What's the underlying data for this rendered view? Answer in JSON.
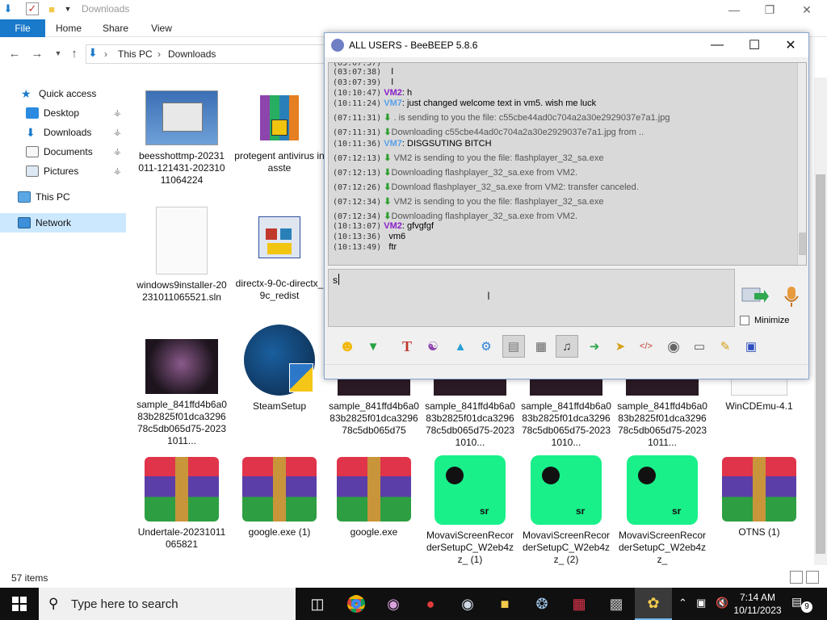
{
  "explorer": {
    "title": "Downloads",
    "ribbon_tabs": [
      "File",
      "Home",
      "Share",
      "View"
    ],
    "breadcrumb": [
      "This PC",
      "Downloads"
    ],
    "nav": [
      {
        "label": "Quick access",
        "icon": "star-icon",
        "pinned": false
      },
      {
        "label": "Desktop",
        "icon": "desktop-icon",
        "pinned": true
      },
      {
        "label": "Downloads",
        "icon": "download-arrow-icon",
        "pinned": true
      },
      {
        "label": "Documents",
        "icon": "documents-icon",
        "pinned": true
      },
      {
        "label": "Pictures",
        "icon": "pictures-icon",
        "pinned": true
      },
      {
        "label": "This PC",
        "icon": "computer-icon",
        "pinned": false
      },
      {
        "label": "Network",
        "icon": "network-icon",
        "pinned": false,
        "selected": true
      }
    ],
    "files": [
      {
        "name": "beesshottmp-20231011-121431-20231011064224",
        "kind": "screenshot"
      },
      {
        "name": "protegent antivirus inasste",
        "kind": "winrar-installer"
      },
      {
        "name": "windows9installer-20231011065521.sln",
        "kind": "blank"
      },
      {
        "name": "directx-9-0c-directx_9c_redist",
        "kind": "installer"
      },
      {
        "name": "sample_841ffd4b6a083b2825f01dca329678c5db065d75-20231011...",
        "kind": "dark-image"
      },
      {
        "name": "SteamSetup",
        "kind": "steam"
      },
      {
        "name": "sample_841ffd4b6a083b2825f01dca329678c5db065d75",
        "kind": "dark-image"
      },
      {
        "name": "sample_841ffd4b6a083b2825f01dca329678c5db065d75-20231010...",
        "kind": "dark-image"
      },
      {
        "name": "sample_841ffd4b6a083b2825f01dca329678c5db065d75-20231010...",
        "kind": "dark-image"
      },
      {
        "name": "sample_841ffd4b6a083b2825f01dca329678c5db065d75-20231011...",
        "kind": "dark-image"
      },
      {
        "name": "WinCDEmu-4.1",
        "kind": "blank"
      },
      {
        "name": "Undertale-20231011065821",
        "kind": "rar"
      },
      {
        "name": "google.exe (1)",
        "kind": "rar"
      },
      {
        "name": "google.exe",
        "kind": "rar"
      },
      {
        "name": "MovaviScreenRecorderSetupC_W2eb4zz_ (1)",
        "kind": "movavi"
      },
      {
        "name": "MovaviScreenRecorderSetupC_W2eb4zz_ (2)",
        "kind": "movavi"
      },
      {
        "name": "MovaviScreenRecorderSetupC_W2eb4zz_",
        "kind": "movavi"
      },
      {
        "name": "OTNS (1)",
        "kind": "rar"
      }
    ],
    "status": "57 items"
  },
  "beebeep": {
    "title": "ALL USERS - BeeBEEP 5.8.6",
    "messages": [
      {
        "time": "(03:07:38)",
        "user": "",
        "text": "l",
        "type": "plain"
      },
      {
        "time": "(03:07:39)",
        "user": "",
        "text": "l",
        "type": "plain"
      },
      {
        "time": "(10:10:47)",
        "user": "VM2",
        "text": ": h",
        "type": "vm2"
      },
      {
        "time": "(10:11:24)",
        "user": "VM7",
        "text": ": just changed welcome text in vm5. wish me luck",
        "type": "vm7"
      },
      {
        "time": "(07:11:31)",
        "user": "",
        "text": ". is sending to you the file: c55cbe44ad0c704a2a30e2929037e7a1.jpg",
        "type": "sys"
      },
      {
        "time": "(07:11:31)",
        "user": "",
        "text": "Downloading c55cbe44ad0c704a2a30e2929037e7a1.jpg from ..",
        "type": "sys"
      },
      {
        "time": "(10:11:36)",
        "user": "VM7",
        "text": ": DISGSUTING BITCH",
        "type": "vm7"
      },
      {
        "time": "(07:12:13)",
        "user": "",
        "text": "VM2 is sending to you the file: flashplayer_32_sa.exe",
        "type": "sys"
      },
      {
        "time": "(07:12:13)",
        "user": "",
        "text": "Downloading flashplayer_32_sa.exe from VM2.",
        "type": "sys"
      },
      {
        "time": "(07:12:26)",
        "user": "",
        "text": "Download flashplayer_32_sa.exe from VM2: transfer canceled.",
        "type": "sys"
      },
      {
        "time": "(07:12:34)",
        "user": "",
        "text": "VM2 is sending to you the file: flashplayer_32_sa.exe",
        "type": "sys"
      },
      {
        "time": "(07:12:34)",
        "user": "",
        "text": "Downloading flashplayer_32_sa.exe from VM2.",
        "type": "sys"
      },
      {
        "time": "(10:13:07)",
        "user": "VM2",
        "text": ": gfvgfgf",
        "type": "vm2"
      },
      {
        "time": "(10:13:36)",
        "user": "",
        "text": "vm6",
        "type": "plain"
      },
      {
        "time": "(10:13:49)",
        "user": "",
        "text": "ftr",
        "type": "plain"
      }
    ],
    "input_value": "s",
    "minimize_label": "Minimize",
    "toolbar": [
      "emoticon-icon",
      "marker-icon",
      "font-icon",
      "color-palette-icon",
      "filter-icon",
      "settings-gear-icon",
      "inbox-icon",
      "text-box-icon",
      "music-note-icon",
      "send-file-icon",
      "folder-arrow-icon",
      "code-icon",
      "camera-icon",
      "screen-icon",
      "notes-icon",
      "save-icon"
    ],
    "user_colors": {
      "VM2": "#8b20c8",
      "VM7": "#5aa0e6"
    }
  },
  "taskbar": {
    "search_placeholder": "Type here to search",
    "apps": [
      "task-view-icon",
      "chrome-icon",
      "paint-icon",
      "flash-icon",
      "steam-icon",
      "file-explorer-icon",
      "movie-icon",
      "winrar-icon",
      "network-app-icon",
      "beebeep-icon"
    ],
    "time": "7:14 AM",
    "date": "10/11/2023",
    "notifications": "9"
  }
}
